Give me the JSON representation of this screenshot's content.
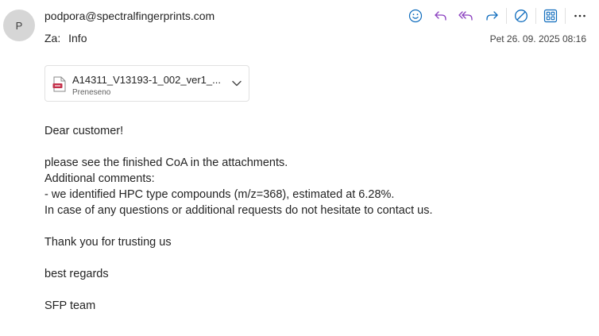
{
  "header": {
    "avatar_initial": "P",
    "sender": "podpora@spectralfingerprints.com",
    "to_label": "Za:",
    "to_value": "Info",
    "date": "Pet 26. 09. 2025 08:16"
  },
  "toolbar": {
    "items": [
      "emoji-icon",
      "reply-icon",
      "reply-all-icon",
      "forward-icon",
      "block-icon",
      "apps-icon",
      "more-icon"
    ],
    "accent_color": "#0f6cbd",
    "reply_color": "#8a3fbf"
  },
  "attachment": {
    "name": "A14311_V13193-1_002_ver1_...",
    "status": "Preneseno"
  },
  "message": {
    "greeting": "Dear customer!",
    "line1": "please see the finished CoA in the attachments.",
    "line2": "Additional comments:",
    "line3": "- we identified HPC type compounds (m/z=368), estimated at 6.28%.",
    "line4": "In case of any questions or additional requests do not hesitate to contact us.",
    "thanks": "Thank you for trusting us",
    "regards": "best regards",
    "signature": "SFP team"
  }
}
